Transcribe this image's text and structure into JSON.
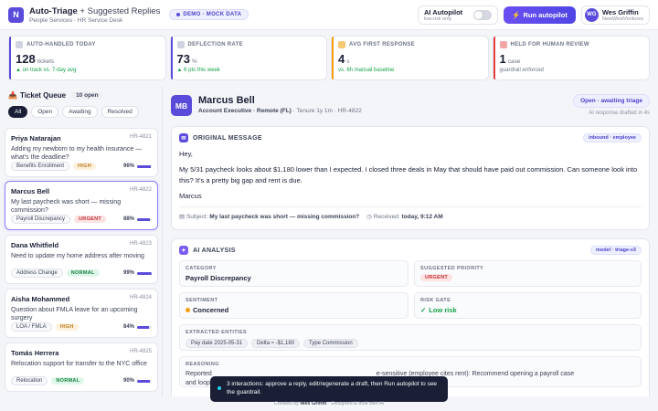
{
  "header": {
    "logo_letter": "N",
    "title": "Auto-Triage",
    "title_suffix": "+ Suggested Replies",
    "subtitle": "People Services · HR Service Desk",
    "demo_badge": "DEMO · MOCK DATA",
    "autopilot_label": "AI Autopilot",
    "autopilot_sub": "low-risk only",
    "autopilot_on": false,
    "run_button": "Run autopilot",
    "user_initials": "WG",
    "user_name": "Wes Griffin",
    "user_org": "NewWestVentures"
  },
  "stats": [
    {
      "label": "AUTO-HANDLED TODAY",
      "value": "128",
      "unit": "tickets",
      "note": "▲ on track vs. 7-day avg",
      "accent": "#5b4bdb"
    },
    {
      "label": "DEFLECTION RATE",
      "value": "73",
      "unit": "%",
      "note": "▲ 6 pts this week",
      "accent": "#5b4bdb"
    },
    {
      "label": "AVG FIRST RESPONSE",
      "value": "4",
      "unit": "s",
      "note": "vs. 6h manual baseline",
      "accent": "#f59e0b"
    },
    {
      "label": "HELD FOR HUMAN REVIEW",
      "value": "1",
      "unit": "case",
      "note": "guardrail enforced",
      "accent": "#e53e3e"
    }
  ],
  "queue": {
    "title": "Ticket Queue",
    "count": "10 open",
    "filters": [
      "All",
      "Open",
      "Awaiting",
      "Resolved"
    ],
    "tickets": [
      {
        "name": "Priya Natarajan",
        "id": "HR-4821",
        "subject": "Adding my newborn to my health insurance — what's the deadline?",
        "category": "Benefits Enrollment",
        "priority": "HIGH",
        "priority_class": "high",
        "confidence": "96%",
        "confidence_value": 0.96
      },
      {
        "name": "Marcus Bell",
        "id": "HR-4822",
        "subject": "My last paycheck was short — missing commission?",
        "category": "Payroll Discrepancy",
        "priority": "URGENT",
        "priority_class": "urgent",
        "confidence": "88%",
        "confidence_value": 0.88
      },
      {
        "name": "Dana Whitfield",
        "id": "HR-4823",
        "subject": "Need to update my home address after moving",
        "category": "Address Change",
        "priority": "NORMAL",
        "priority_class": "normal",
        "confidence": "99%",
        "confidence_value": 0.99
      },
      {
        "name": "Aisha Mohammed",
        "id": "HR-4824",
        "subject": "Question about FMLA leave for an upcoming surgery",
        "category": "LOA / FMLA",
        "priority": "HIGH",
        "priority_class": "high",
        "confidence": "84%",
        "confidence_value": 0.84
      },
      {
        "name": "Tomás Herrera",
        "id": "HR-4825",
        "subject": "Relocation support for transfer to the NYC office",
        "category": "Relocation",
        "priority": "NORMAL",
        "priority_class": "normal",
        "confidence": "90%",
        "confidence_value": 0.9
      }
    ]
  },
  "requester": {
    "initials": "MB",
    "name": "Marcus Bell",
    "role": "Account Executive · Remote (FL)",
    "meta": "· Tenure 1y 1m · HR-4822",
    "status": "Open · awaiting triage",
    "drafted": "AI response drafted in 4s"
  },
  "original": {
    "title": "ORIGINAL MESSAGE",
    "badge": "inbound · employee",
    "greeting": "Hey,",
    "body": "My 5/31 paycheck looks about $1,180 lower than I expected. I closed three deals in May that should have paid out commission. Can someone look into this? It's a pretty big gap and rent is due.",
    "signoff": "Marcus",
    "subject_label": "Subject:",
    "subject": "My last paycheck was short — missing commission?",
    "received_label": "Received:",
    "received": "today, 9:12 AM"
  },
  "analysis": {
    "title": "AI ANALYSIS",
    "badge": "model · triage-v3",
    "category_label": "CATEGORY",
    "category": "Payroll Discrepancy",
    "priority_label": "SUGGESTED PRIORITY",
    "priority": "URGENT",
    "sentiment_label": "SENTIMENT",
    "sentiment": "Concerned",
    "risk_label": "RISK GATE",
    "risk": "Low risk",
    "entities_label": "EXTRACTED ENTITIES",
    "entities": [
      "Pay date 2025-05-31",
      "Delta ≈ -$1,180",
      "Type Commission"
    ],
    "reasoning_label": "REASONING",
    "reasoning_start": "Reported",
    "reasoning_end": "e-sensitive (employee cites rent): Recommend opening a payroll case",
    "reasoning_line2": "and loopi"
  },
  "toast": "3 interactions: approve a reply, edit/regenerate a draft, then Run autopilot to see the guardrail.",
  "footer": {
    "prefix": "Created by",
    "name": "Wes Griffin",
    "suffix": "· Designed & built with AI"
  }
}
